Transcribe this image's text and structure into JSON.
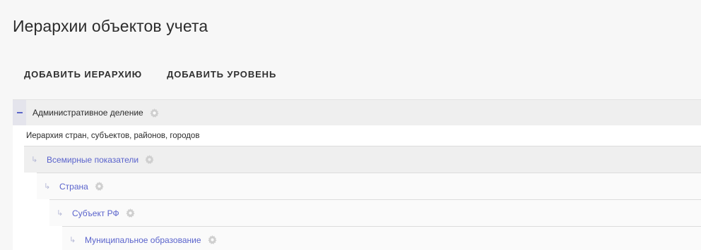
{
  "page": {
    "title": "Иерархии объектов учета"
  },
  "toolbar": {
    "add_hierarchy": "ДОБАВИТЬ ИЕРАРХИЮ",
    "add_level": "ДОБАВИТЬ УРОВЕНЬ"
  },
  "hierarchy": {
    "name": "Административное деление",
    "description": "Иерархия стран, субъектов, районов, городов",
    "levels": [
      {
        "label": "Всемирные показатели"
      },
      {
        "label": "Страна"
      },
      {
        "label": "Субъект РФ"
      },
      {
        "label": "Муниципальное образование"
      }
    ]
  },
  "icons": {
    "collapse": "minus-icon",
    "settings": "gear-icon",
    "child": "child-arrow-icon"
  },
  "colors": {
    "accent": "#5a63cc",
    "muted_icon": "#c8c8c8"
  }
}
